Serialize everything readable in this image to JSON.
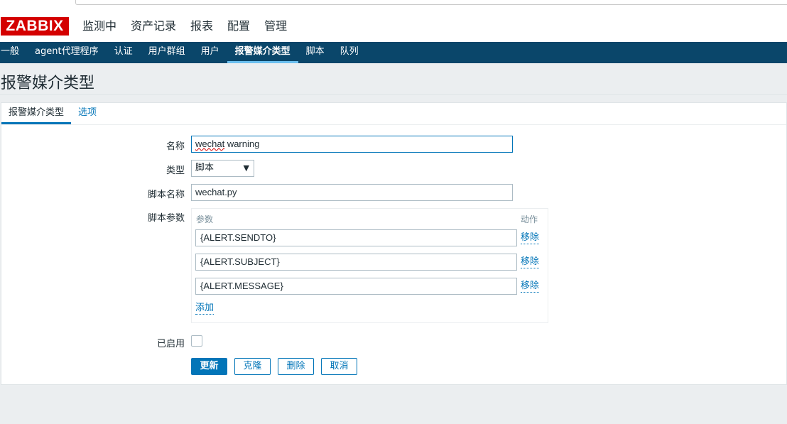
{
  "logo": "ZABBIX",
  "main_menu": [
    {
      "label": "监测中"
    },
    {
      "label": "资产记录"
    },
    {
      "label": "报表"
    },
    {
      "label": "配置"
    },
    {
      "label": "管理"
    }
  ],
  "sub_menu": [
    {
      "label": "一般"
    },
    {
      "label": "agent代理程序"
    },
    {
      "label": "认证"
    },
    {
      "label": "用户群组"
    },
    {
      "label": "用户"
    },
    {
      "label": "报警媒介类型"
    },
    {
      "label": "脚本"
    },
    {
      "label": "队列"
    }
  ],
  "page_title": "报警媒介类型",
  "tabs": [
    {
      "label": "报警媒介类型"
    },
    {
      "label": "选项"
    }
  ],
  "form": {
    "name_label": "名称",
    "name_value_word1": "wechat",
    "name_value_rest": " warning",
    "type_label": "类型",
    "type_value": "脚本",
    "type_arrow": "▼",
    "script_name_label": "脚本名称",
    "script_name_value": "wechat.py",
    "script_params_label": "脚本参数",
    "params_col_header": "参数",
    "actions_col_header": "动作",
    "params": [
      {
        "value": "{ALERT.SENDTO}",
        "remove": "移除"
      },
      {
        "value": "{ALERT.SUBJECT}",
        "remove": "移除"
      },
      {
        "value": "{ALERT.MESSAGE}",
        "remove": "移除"
      }
    ],
    "add_label": "添加",
    "enabled_label": "已启用"
  },
  "buttons": {
    "update": "更新",
    "clone": "克隆",
    "delete": "删除",
    "cancel": "取消"
  },
  "colors": {
    "brand_red": "#d40000",
    "nav_dark": "#0a466a",
    "link_blue": "#0275b8"
  }
}
